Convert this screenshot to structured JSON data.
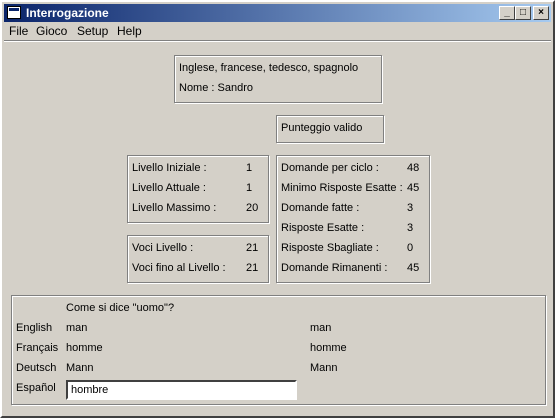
{
  "window": {
    "title": "Interrogazione"
  },
  "titlebar_buttons": {
    "minimize": "_",
    "maximize": "□",
    "close": "×"
  },
  "menu": [
    "File",
    "Gioco",
    "Setup",
    "Help"
  ],
  "info": {
    "languages": "Inglese, francese, tedesco, spagnolo",
    "name": "Nome : Sandro"
  },
  "score_status": "Punteggio valido",
  "levels": [
    {
      "label": "Livello Iniziale :",
      "value": "1"
    },
    {
      "label": "Livello Attuale  :",
      "value": "1"
    },
    {
      "label": "Livello Massimo  :",
      "value": "20"
    }
  ],
  "voci": [
    {
      "label": "Voci Livello      :",
      "value": "21"
    },
    {
      "label": "Voci fino al Livello :",
      "value": "21"
    }
  ],
  "stats": [
    {
      "label": "Domande per ciclo :",
      "value": "48"
    },
    {
      "label": "Minimo Risposte Esatte :",
      "value": "45"
    },
    {
      "label": "Domande fatte :",
      "value": "3"
    },
    {
      "label": "Risposte Esatte :",
      "value": "3"
    },
    {
      "label": "Risposte Sbagliate :",
      "value": "0"
    },
    {
      "label": "Domande Rimanenti :",
      "value": "45"
    }
  ],
  "quiz": {
    "question": "Come si dice \"uomo\"?",
    "rows": [
      {
        "lang": "English",
        "answer": "man",
        "correct": "man"
      },
      {
        "lang": "Français",
        "answer": "homme",
        "correct": "homme"
      },
      {
        "lang": "Deutsch",
        "answer": "Mann",
        "correct": "Mann"
      }
    ],
    "input_lang": "Español",
    "input_value": "hombre"
  }
}
